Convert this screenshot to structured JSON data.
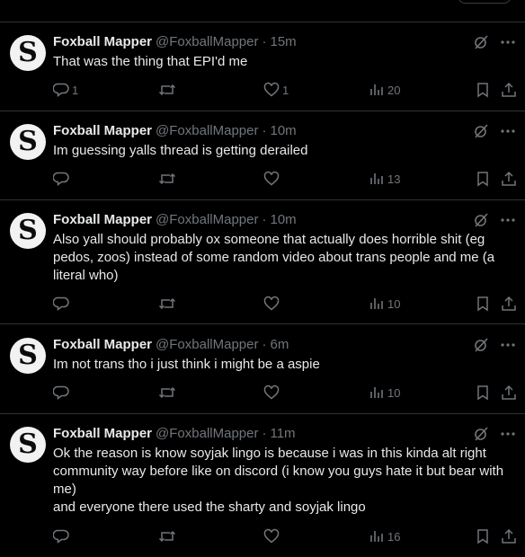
{
  "posts": [
    {
      "name": "Foxball Mapper",
      "handle": "@FoxballMapper",
      "time": "15m",
      "text": "That was the thing that EPI'd me",
      "replies": "1",
      "reposts": "",
      "likes": "1",
      "views": "20"
    },
    {
      "name": "Foxball Mapper",
      "handle": "@FoxballMapper",
      "time": "10m",
      "text": "Im guessing yalls thread is getting derailed",
      "replies": "",
      "reposts": "",
      "likes": "",
      "views": "13"
    },
    {
      "name": "Foxball Mapper",
      "handle": "@FoxballMapper",
      "time": "10m",
      "text": "Also yall should probably ox someone that actually does horrible shit (eg pedos, zoos) instead of some random video about trans people and me (a literal who)",
      "replies": "",
      "reposts": "",
      "likes": "",
      "views": "10"
    },
    {
      "name": "Foxball Mapper",
      "handle": "@FoxballMapper",
      "time": "6m",
      "text": "Im not trans tho i just think i might be a aspie",
      "replies": "",
      "reposts": "",
      "likes": "",
      "views": "10"
    },
    {
      "name": "Foxball Mapper",
      "handle": "@FoxballMapper",
      "time": "11m",
      "text": "Ok the reason is know soyjak lingo is because i was in this kinda alt right community way before like on discord (i know you guys hate it but bear with me)\nand everyone there used the sharty and soyjak lingo",
      "replies": "",
      "reposts": "",
      "likes": "",
      "views": "16"
    }
  ],
  "avatar_letter": "S",
  "icons": {
    "reply": "reply-icon",
    "repost": "repost-icon",
    "like": "like-icon",
    "views": "views-icon",
    "bookmark": "bookmark-icon",
    "share": "share-icon",
    "grok": "grok-icon",
    "more": "more-icon"
  },
  "colors": {
    "background": "#000000",
    "text": "#e7e9ea",
    "muted": "#71767b",
    "divider": "#2f3336"
  }
}
